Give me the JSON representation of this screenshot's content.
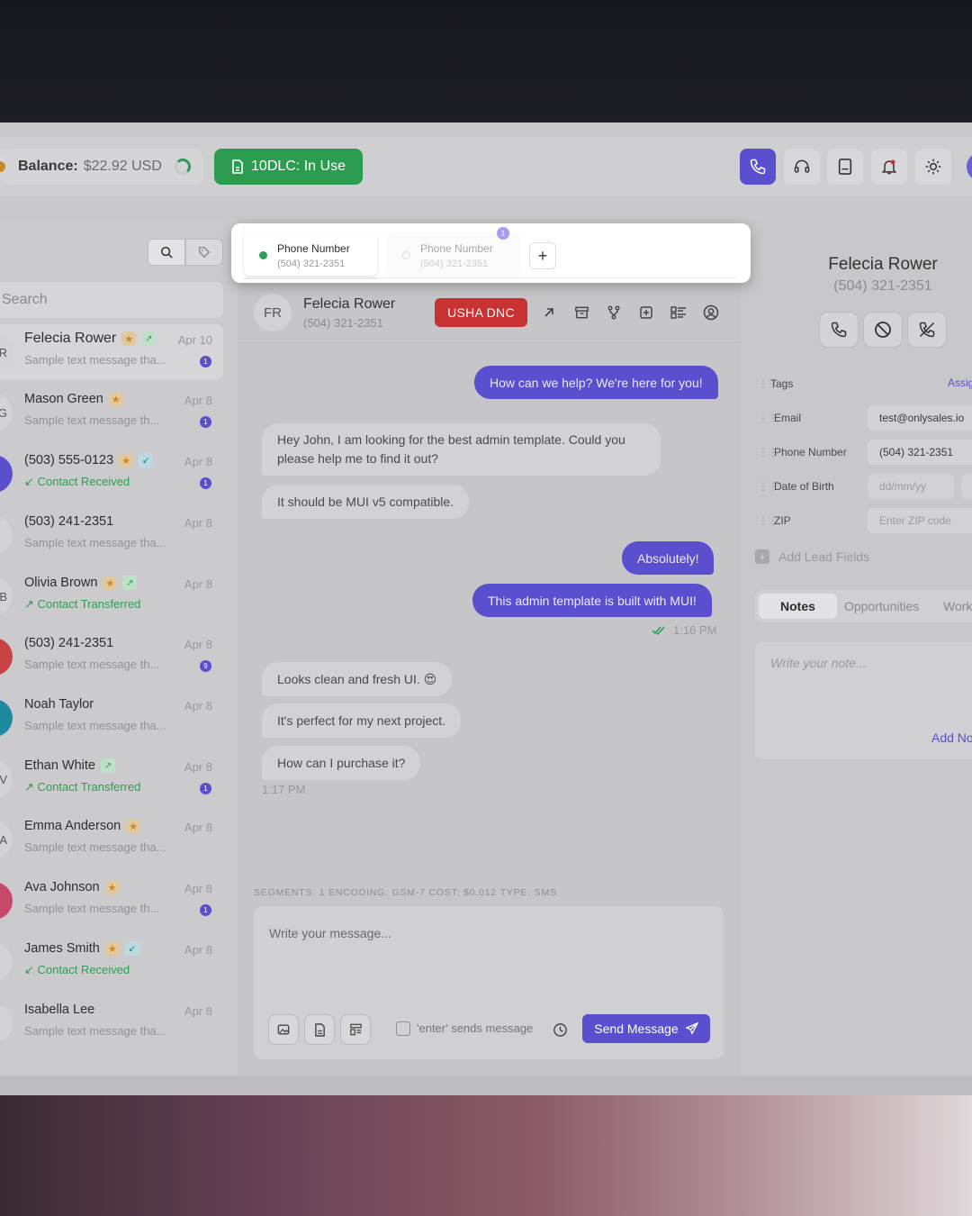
{
  "topbar": {
    "balance_label": "Balance:",
    "balance_value": "$22.92 USD",
    "dlc_label": "10DLC: In Use"
  },
  "left": {
    "search_placeholder": "Search",
    "contacts": [
      {
        "initial": "R",
        "name": "Felecia Rower",
        "date": "Apr 10",
        "sub": "Sample text message tha...",
        "badge": "1",
        "star": true,
        "arrow": "out",
        "sub_green": false,
        "avatar_color": "#d3d3d5"
      },
      {
        "initial": "G",
        "name": "Mason Green",
        "date": "Apr 8",
        "sub": "Sample text message th...",
        "badge": "1",
        "star": true,
        "arrow": "",
        "sub_green": false,
        "avatar_color": "#d3d3d5"
      },
      {
        "initial": "",
        "name": "(503) 555-0123",
        "date": "Apr 8",
        "sub": "Contact Received",
        "badge": "1",
        "star": true,
        "arrow": "in",
        "sub_green": true,
        "avatar_color": "#5a4fcf"
      },
      {
        "initial": "",
        "name": "(503) 241-2351",
        "date": "Apr 8",
        "sub": "Sample text message tha...",
        "badge": "",
        "star": false,
        "arrow": "",
        "sub_green": false,
        "avatar_color": "#d3d3d5"
      },
      {
        "initial": "B",
        "name": "Olivia Brown",
        "date": "Apr 8",
        "sub": "Contact Transferred",
        "badge": "",
        "star": true,
        "arrow": "out",
        "sub_green": true,
        "avatar_color": "#d3d3d5"
      },
      {
        "initial": "",
        "name": "(503) 241-2351",
        "date": "Apr 8",
        "sub": "Sample text message th...",
        "badge": "9",
        "star": false,
        "arrow": "",
        "sub_green": false,
        "avatar_color": "#c84444"
      },
      {
        "initial": "",
        "name": "Noah Taylor",
        "date": "Apr 8",
        "sub": "Sample text message tha...",
        "badge": "",
        "star": false,
        "arrow": "",
        "sub_green": false,
        "avatar_color": "#1d8aa0"
      },
      {
        "initial": "V",
        "name": "Ethan White",
        "date": "Apr 8",
        "sub": "Contact Transferred",
        "badge": "1",
        "star": false,
        "arrow": "out",
        "sub_green": true,
        "avatar_color": "#d3d3d5"
      },
      {
        "initial": "A",
        "name": "Emma Anderson",
        "date": "Apr 8",
        "sub": "Sample text message tha...",
        "badge": "",
        "star": true,
        "arrow": "",
        "sub_green": false,
        "avatar_color": "#d3d3d5"
      },
      {
        "initial": "",
        "name": "Ava Johnson",
        "date": "Apr 8",
        "sub": "Sample text message th...",
        "badge": "1",
        "star": true,
        "arrow": "",
        "sub_green": false,
        "avatar_color": "#c8486a"
      },
      {
        "initial": "",
        "name": "James Smith",
        "date": "Apr 8",
        "sub": "Contact Received",
        "badge": "",
        "star": true,
        "arrow": "in",
        "sub_green": true,
        "avatar_color": "#d3d3d5"
      },
      {
        "initial": "",
        "name": "Isabella Lee",
        "date": "Apr 8",
        "sub": "Sample text message tha...",
        "badge": "",
        "star": false,
        "arrow": "",
        "sub_green": false,
        "avatar_color": "#d3d3d5"
      }
    ]
  },
  "chat": {
    "avatar_initials": "FR",
    "name": "Felecia Rower",
    "phone": "(504) 321-2351",
    "dnc_label": "USHA DNC",
    "messages": {
      "m1": "How can we help? We're here for you!",
      "m2": "Hey John, I am looking for the best admin template. Could you please help me to find it out?",
      "m3": "It should be MUI v5 compatible.",
      "m4": "Absolutely!",
      "m5": "This admin template is built with MUI!",
      "t1": "1:16 PM",
      "m6": "Looks clean and fresh UI. 😍",
      "m7": "It's perfect for my next project.",
      "m8": "How can I purchase it?",
      "t2": "1:17 PM"
    },
    "meta": "SEGMENTS: 1   ENCODING: GSM-7   COST: $0.012   TYPE: SMS",
    "compose_placeholder": "Write your message...",
    "enter_label": "'enter' sends message",
    "send_label": "Send Message"
  },
  "right": {
    "name": "Felecia Rower",
    "phone": "(504) 321-2351",
    "tags_label": "Tags",
    "assign_label": "Assig",
    "email_label": "Email",
    "email_value": "test@onlysales.io",
    "phone_label": "Phone Number",
    "phone_value": "(504) 321-2351",
    "dob_label": "Date of Birth",
    "dob_placeholder": "dd/mm/yy",
    "zip_label": "ZIP",
    "zip_placeholder": "Enter ZIP code",
    "add_lead_label": "Add Lead Fields",
    "tabs": {
      "notes": "Notes",
      "opportunities": "Opportunities",
      "work": "Work"
    },
    "note_placeholder": "Write your note...",
    "add_note_label": "Add No"
  },
  "modal": {
    "tab1_label": "Phone Number",
    "tab1_phone": "(504) 321-2351",
    "tab2_label": "Phone Number",
    "tab2_phone": "(504) 321-2351",
    "notif": "1"
  },
  "colors": {
    "accent": "#5a4fcf",
    "success": "#2c9c50",
    "danger": "#c83232"
  }
}
